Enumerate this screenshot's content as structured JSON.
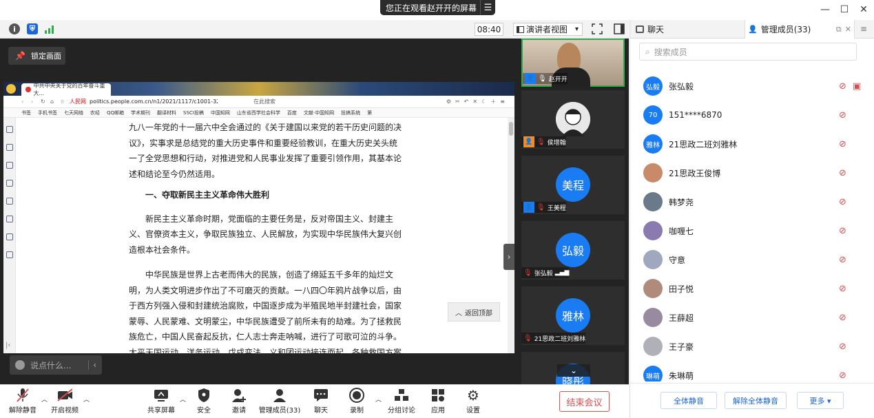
{
  "banner": {
    "text": "您正在观看赵开开的屏幕",
    "menu_glyph": "☰"
  },
  "window": {
    "minimize": "—",
    "maximize": "☐",
    "close": "✕"
  },
  "topbar": {
    "clock": "08:40",
    "view_label": "演讲者视图",
    "view_caret": "▾"
  },
  "stage": {
    "lock_label": "锁定画面",
    "chat_placeholder": "说点什么...",
    "collapse_glyph": "›",
    "back_to_top": "返回顶部",
    "scroll_down": "⌄"
  },
  "browser": {
    "tab_title": "中共中央关于党的百年奋斗重大...",
    "url_site": "人民网",
    "url": "politics.people.com.cn/n1/2021/1117/c1001-3228",
    "search_placeholder": "在此搜索",
    "bookmarks": [
      "书签",
      "手机书签",
      "七天网络",
      "农经",
      "QQ邮箱",
      "学术期刊",
      "翻译材料",
      "SSCI投稿",
      "中国知网",
      "山东省西学社会科学",
      "百度",
      "文献·中国知网",
      "投搞系统",
      "第"
    ]
  },
  "article": {
    "para1": "九八一年党的十一届六中全会通过的《关于建国以来党的若干历史问题的决议》，实事求是总结党的重大历史事件和重要经验教训，在重大历史关头统一了全党思想和行动，对推进党和人民事业发挥了重要引领作用，其基本论述和结论至今仍然适用。",
    "heading": "一、夺取新民主主义革命伟大胜利",
    "para2": "新民主主义革命时期，党面临的主要任务是，反对帝国主义、封建主义、官僚资本主义，争取民族独立、人民解放，为实现中华民族伟大复兴创造根本社会条件。",
    "para3": "中华民族是世界上古老而伟大的民族，创造了绵延五千多年的灿烂文明，为人类文明进步作出了不可磨灭的贡献。一八四〇年鸦片战争以后，由于西方列强入侵和封建统治腐败，中国逐步成为半殖民地半封建社会，国家蒙辱、人民蒙难、文明蒙尘，中华民族遭受了前所未有的劫难。为了拯救民族危亡，中国人民奋起反抗，仁人志士奔走呐喊，进行了可歌可泣的斗争。太平天国运动、洋务运动、戊戌变法、义和团运动接连而起，各种救国方案"
  },
  "video_tiles": [
    {
      "name": "赵开开",
      "avatar": "",
      "role": "host",
      "mic": "on"
    },
    {
      "name": "侯增翰",
      "avatar": "",
      "role": "cohost",
      "mic": "off"
    },
    {
      "name": "王美程",
      "avatar": "美程",
      "role": "host",
      "mic": "off"
    },
    {
      "name": "张弘毅",
      "avatar": "弘毅",
      "role": "none",
      "mic": "off"
    },
    {
      "name": "21思政二班刘雅林",
      "avatar": "雅林",
      "role": "none",
      "mic": "off"
    },
    {
      "name": "",
      "avatar": "晓彤",
      "role": "none",
      "mic": "off"
    }
  ],
  "bottombar": {
    "unmute": "解除静音",
    "video": "开启视频",
    "share": "共享屏幕",
    "security": "安全",
    "invite": "邀请",
    "members": "管理成员(33)",
    "chat": "聊天",
    "record": "录制",
    "breakout": "分组讨论",
    "apps": "应用",
    "settings": "设置",
    "end": "结束会议"
  },
  "rpanel": {
    "tab_chat": "聊天",
    "tab_members": "管理成员(33)",
    "search_placeholder": "搜索成员",
    "members": [
      {
        "name": "张弘毅",
        "avatar": "弘毅",
        "color": "#1a7cf3",
        "cam": true
      },
      {
        "name": "151****6870",
        "avatar": "70",
        "color": "#1a7cf3",
        "cam": false
      },
      {
        "name": "21思政二班刘雅林",
        "avatar": "雅林",
        "color": "#1a7cf3",
        "cam": false
      },
      {
        "name": "21思政王俊博",
        "avatar": "",
        "color": "#c98a6a",
        "cam": false
      },
      {
        "name": "韩梦尧",
        "avatar": "",
        "color": "#6a7a8a",
        "cam": false
      },
      {
        "name": "咖喱七",
        "avatar": "",
        "color": "#8a7ab0",
        "cam": false
      },
      {
        "name": "守意",
        "avatar": "",
        "color": "#a0a8c0",
        "cam": false
      },
      {
        "name": "田子悦",
        "avatar": "",
        "color": "#b08a7a",
        "cam": false
      },
      {
        "name": "王薛超",
        "avatar": "",
        "color": "#9a8aa0",
        "cam": false
      },
      {
        "name": "王子豪",
        "avatar": "",
        "color": "#b0b0b8",
        "cam": false
      },
      {
        "name": "朱琳萌",
        "avatar": "琳萌",
        "color": "#1a7cf3",
        "cam": false
      }
    ],
    "mute_all": "全体静音",
    "unmute_all": "解除全体静音",
    "more": "更多 ▾"
  }
}
